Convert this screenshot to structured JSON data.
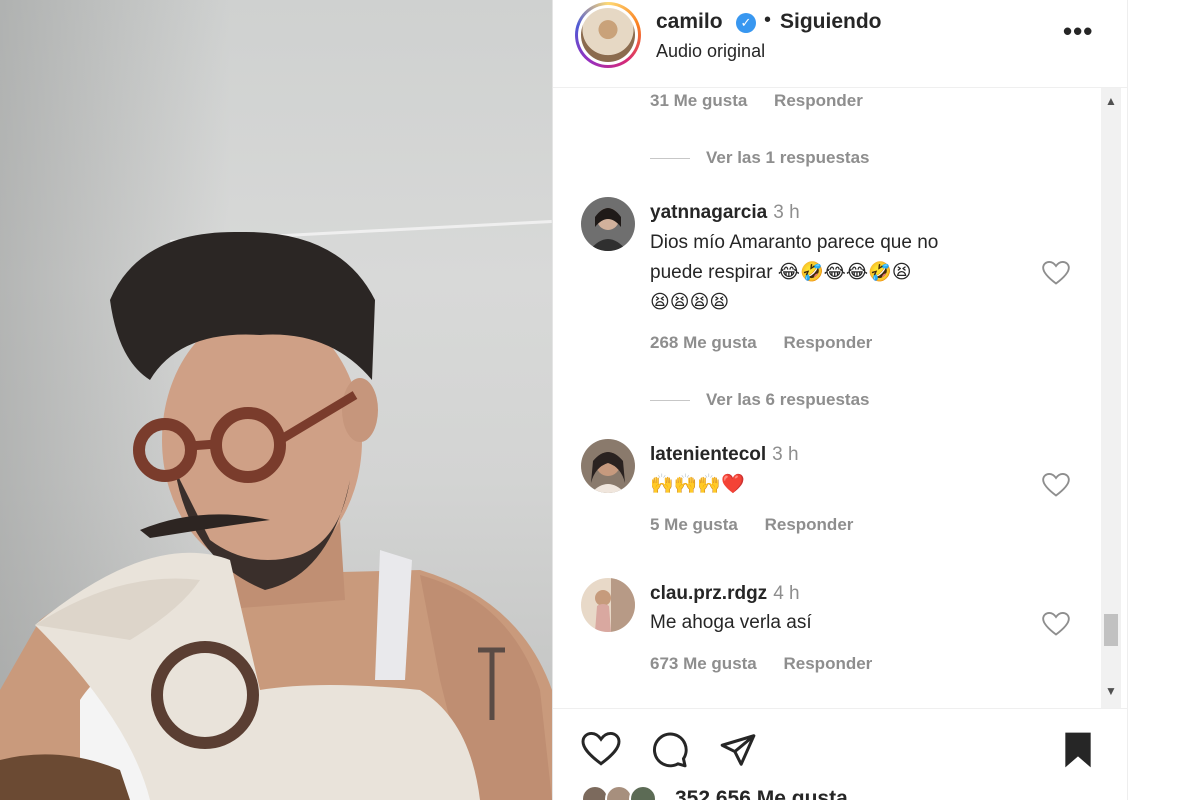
{
  "post": {
    "username": "camilo",
    "separator": "•",
    "follow_state": "Siguiendo",
    "audio": "Audio original",
    "verified_icon": "verified-badge-icon",
    "more_icon": "more-options-icon"
  },
  "comments": {
    "top_meta": {
      "likes": "31 Me gusta",
      "reply": "Responder"
    },
    "thread1_replies": "Ver las 1 respuestas",
    "items": [
      {
        "username": "yatnnagarcia",
        "time": "3 h",
        "text_line1": "Dios mío Amaranto parece que no",
        "text_line2": "puede respirar 😂🤣😂😂🤣😫",
        "text_line3": "😫😫😫😫",
        "likes": "268 Me gusta",
        "reply": "Responder"
      },
      {
        "username": "latenientecol",
        "time": "3 h",
        "text_line1": "🙌🙌🙌❤️",
        "likes": "5 Me gusta",
        "reply": "Responder"
      },
      {
        "username": "clau.prz.rdgz",
        "time": "4 h",
        "text_line1": "Me ahoga verla así",
        "likes": "673 Me gusta",
        "reply": "Responder"
      }
    ],
    "thread2_replies": "Ver las 6 respuestas"
  },
  "actions": {
    "like_icon": "heart-icon",
    "comment_icon": "comment-icon",
    "share_icon": "share-icon",
    "save_icon": "bookmark-icon",
    "likes_count": "352.656 Me gusta"
  },
  "colors": {
    "text": "#262626",
    "muted": "#8e8e8e",
    "verified": "#3897f0"
  }
}
